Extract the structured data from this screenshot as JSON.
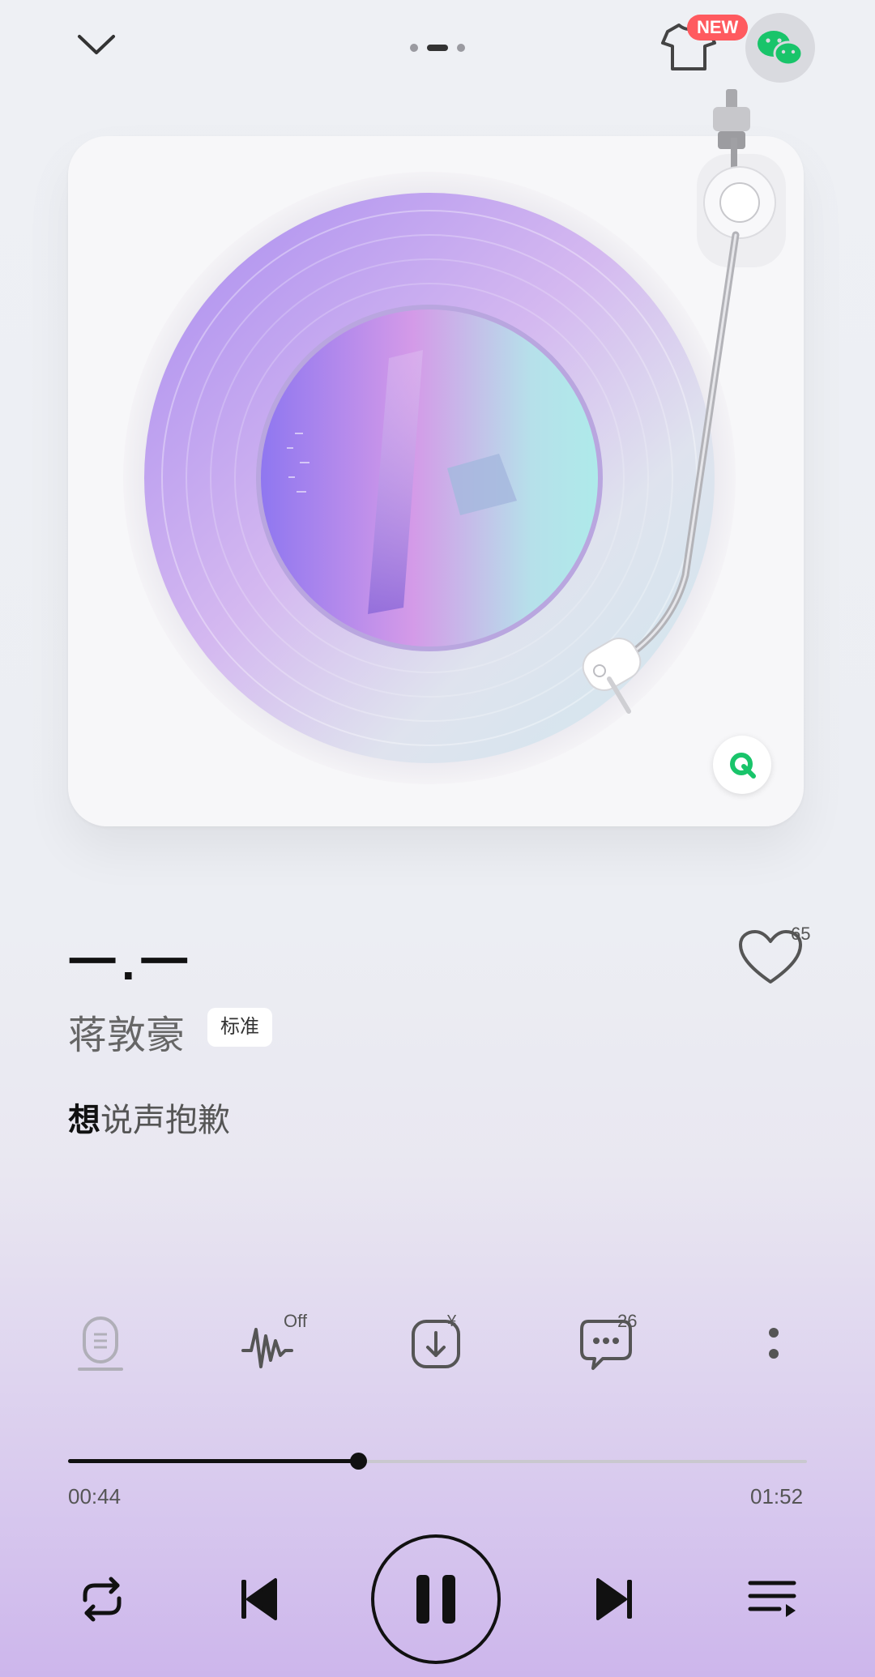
{
  "top_bar": {
    "new_badge": "NEW"
  },
  "song": {
    "title": "一.一",
    "artist": "蒋敦豪",
    "quality": "标准",
    "lyric_sung": "想",
    "lyric_rest": "说声抱歉"
  },
  "likes": "65",
  "actions": {
    "effect_state": "Off",
    "download_badge": "¥",
    "comments_count": "26"
  },
  "progress": {
    "current": "00:44",
    "total": "01:52",
    "fraction": 0.393
  },
  "colors": {
    "accent_green": "#19c46a",
    "new_badge": "#ff5a5f"
  }
}
